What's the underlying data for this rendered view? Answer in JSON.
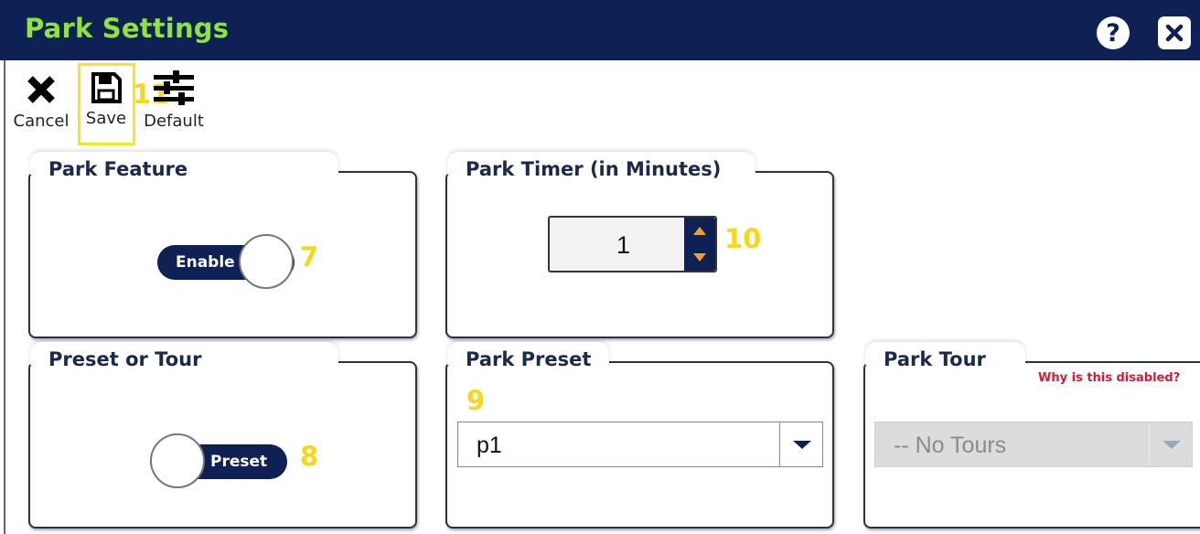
{
  "window": {
    "title": "Park Settings",
    "help_icon": "question-circle-icon",
    "close_icon": "close-x-icon",
    "colors": {
      "titlebar": "#0d2154",
      "title_text": "#8fe33a",
      "accent_orange": "#f2a12a",
      "callout_yellow": "#f7d816",
      "warning_red": "#d11e2e"
    }
  },
  "toolbar": {
    "cancel_label": "Cancel",
    "save_label": "Save",
    "default_label": "Default",
    "cancel_icon": "x-icon",
    "save_icon": "floppy-disk-icon",
    "default_icon": "sliders-icon"
  },
  "callouts": {
    "save": "11",
    "park_feature": "7",
    "preset_or_tour": "8",
    "park_preset": "9",
    "park_timer": "10"
  },
  "park_feature": {
    "title": "Park Feature",
    "toggle_label": "Enable",
    "enabled": true
  },
  "park_timer": {
    "title": "Park Timer (in Minutes)",
    "value": "1"
  },
  "preset_or_tour": {
    "title": "Preset or Tour",
    "toggle_label": "Preset",
    "mode": "preset"
  },
  "park_preset": {
    "title": "Park Preset",
    "selected": "p1"
  },
  "park_tour": {
    "title": "Park Tour",
    "disabled_link": "Why is this disabled?",
    "selected": "-- No Tours",
    "disabled": true
  }
}
